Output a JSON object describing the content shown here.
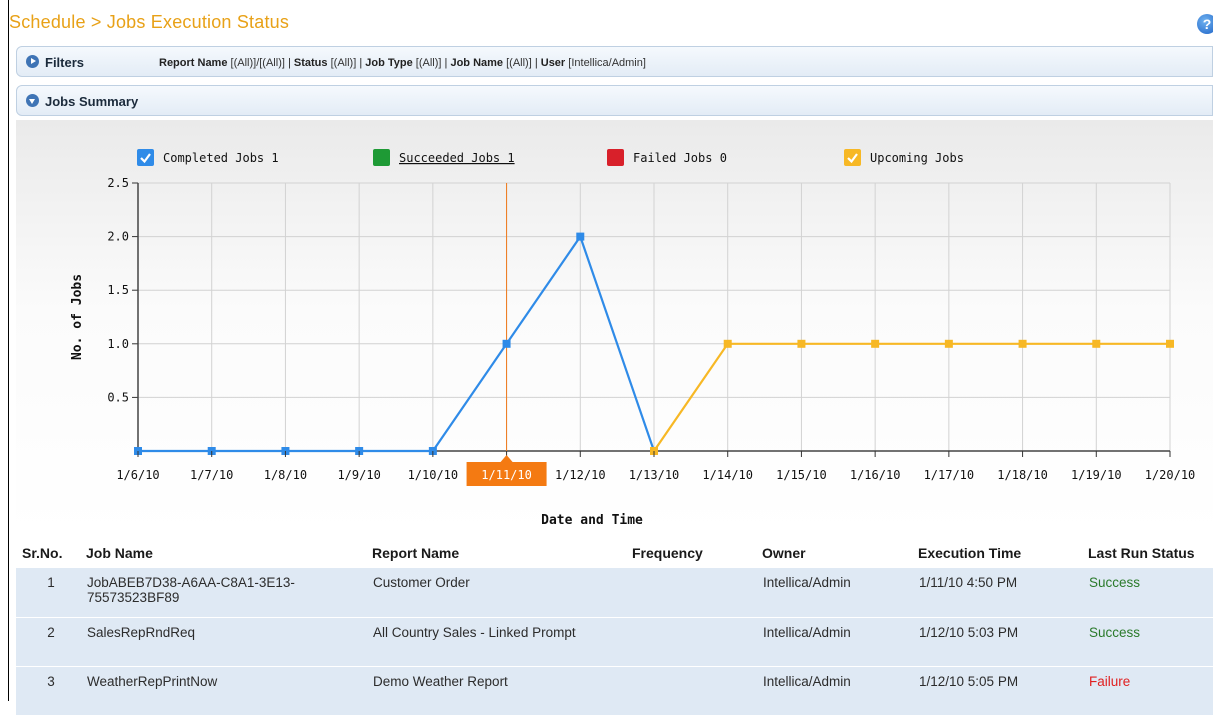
{
  "header": {
    "title": "Schedule > Jobs Execution Status",
    "help_label": "?"
  },
  "filters": {
    "label": "Filters",
    "items": [
      {
        "name": "Report Name",
        "value": "[(All)]/[(All)]"
      },
      {
        "name": "Status",
        "value": "[(All)]"
      },
      {
        "name": "Job Type",
        "value": "[(All)]"
      },
      {
        "name": "Job Name",
        "value": "[(All)]"
      },
      {
        "name": "User",
        "value": "[Intellica/Admin]"
      }
    ]
  },
  "summary": {
    "label": "Jobs Summary"
  },
  "legend": [
    {
      "label": "Completed Jobs",
      "count": "1",
      "color": "#2f8be8",
      "icon": "check-icon"
    },
    {
      "label": "Succeeded Jobs",
      "count": "1",
      "color": "#1e9a35",
      "icon": "square-icon"
    },
    {
      "label": "Failed Jobs",
      "count": "0",
      "color": "#d8202a",
      "icon": "square-icon"
    },
    {
      "label": "Upcoming Jobs",
      "count": "",
      "color": "#f7b825",
      "icon": "check-icon"
    }
  ],
  "chart_data": {
    "type": "line",
    "xlabel": "Date and Time",
    "ylabel": "No. of Jobs",
    "ylim": [
      0,
      2.5
    ],
    "y_ticks": [
      "0.5",
      "1.0",
      "1.5",
      "2.0",
      "2.5"
    ],
    "categories": [
      "1/6/10",
      "1/7/10",
      "1/8/10",
      "1/9/10",
      "1/10/10",
      "1/11/10",
      "1/12/10",
      "1/13/10",
      "1/14/10",
      "1/15/10",
      "1/16/10",
      "1/17/10",
      "1/18/10",
      "1/19/10",
      "1/20/10"
    ],
    "highlighted_category": "1/11/10",
    "grid": true,
    "series": [
      {
        "name": "Completed Jobs",
        "color": "#2f8be8",
        "values": [
          0,
          0,
          0,
          0,
          0,
          1,
          2,
          0,
          null,
          null,
          null,
          null,
          null,
          null,
          null
        ]
      },
      {
        "name": "Upcoming Jobs",
        "color": "#f7b825",
        "values": [
          null,
          null,
          null,
          null,
          null,
          null,
          null,
          0,
          1,
          1,
          1,
          1,
          1,
          1,
          1
        ]
      }
    ]
  },
  "table": {
    "columns": [
      "Sr.No.",
      "Job Name",
      "Report Name",
      "Frequency",
      "Owner",
      "Execution Time",
      "Last Run Status"
    ],
    "rows": [
      {
        "sr": "1",
        "job": "JobABEB7D38-A6AA-C8A1-3E13-75573523BF89",
        "report": "Customer Order",
        "frequency": "",
        "owner": "Intellica/Admin",
        "time": "1/11/10 4:50 PM",
        "status": "Success"
      },
      {
        "sr": "2",
        "job": "SalesRepRndReq",
        "report": "All Country Sales - Linked Prompt",
        "frequency": "",
        "owner": "Intellica/Admin",
        "time": "1/12/10 5:03 PM",
        "status": "Success"
      },
      {
        "sr": "3",
        "job": "WeatherRepPrintNow",
        "report": "Demo Weather Report",
        "frequency": "",
        "owner": "Intellica/Admin",
        "time": "1/12/10 5:05 PM",
        "status": "Failure"
      }
    ]
  }
}
